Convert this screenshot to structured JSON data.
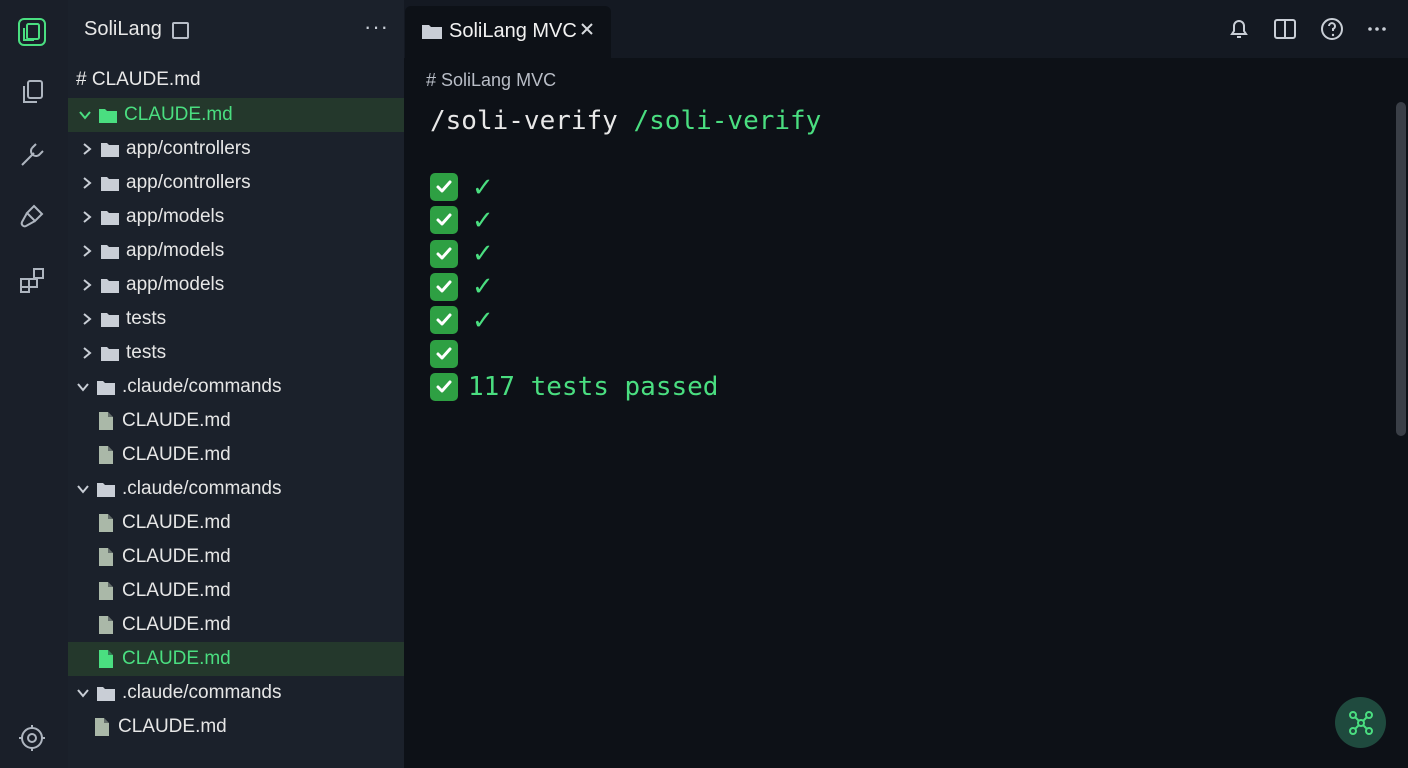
{
  "app": {
    "sidebar_title": "SoliLang",
    "sidebar_more": "···",
    "sidebar_heading": "# CLAUDE.md"
  },
  "activity_icons": [
    "app-logo-icon",
    "copy-files-icon",
    "branch-icon",
    "brush-icon",
    "extensions-icon",
    "settings-gear-icon"
  ],
  "tree": [
    {
      "label": "CLAUDE.md",
      "kind": "folder",
      "expanded": true,
      "active": true
    },
    {
      "label": "app/controllers",
      "kind": "folder",
      "expanded": false
    },
    {
      "label": "app/controllers",
      "kind": "folder",
      "expanded": false
    },
    {
      "label": "app/models",
      "kind": "folder",
      "expanded": false
    },
    {
      "label": "app/models",
      "kind": "folder",
      "expanded": false
    },
    {
      "label": "app/models",
      "kind": "folder",
      "expanded": false
    },
    {
      "label": "tests",
      "kind": "folder",
      "expanded": false
    },
    {
      "label": "tests",
      "kind": "folder",
      "expanded": false
    },
    {
      "label": ".claude/commands",
      "kind": "folder",
      "expanded": true
    },
    {
      "label": "CLAUDE.md",
      "kind": "file"
    },
    {
      "label": "CLAUDE.md",
      "kind": "file"
    },
    {
      "label": ".claude/commands",
      "kind": "folder",
      "expanded": true
    },
    {
      "label": "CLAUDE.md",
      "kind": "file"
    },
    {
      "label": "CLAUDE.md",
      "kind": "file"
    },
    {
      "label": "CLAUDE.md",
      "kind": "file"
    },
    {
      "label": "CLAUDE.md",
      "kind": "file"
    },
    {
      "label": "CLAUDE.md",
      "kind": "file",
      "active": true
    },
    {
      "label": ".claude/commands",
      "kind": "folder",
      "expanded": true
    },
    {
      "label": "CLAUDE.md",
      "kind": "file"
    }
  ],
  "tab": {
    "label": "SoliLang MVC"
  },
  "editor": {
    "breadcrumb": "# SoliLang MVC",
    "command": "/soli-verify",
    "command_echo": "/soli-verify",
    "lines": [
      {
        "tick": "✓"
      },
      {
        "tick": "✓"
      },
      {
        "tick": "✓"
      },
      {
        "tick": "✓"
      },
      {
        "tick": "✓"
      },
      {
        "tick": ""
      },
      {
        "text": "117 tests passed"
      }
    ]
  },
  "colors": {
    "accent_green": "#4ade80",
    "check_bg": "#2ea043",
    "sidebar_bg": "#1b212b",
    "editor_bg": "#0d1117"
  }
}
